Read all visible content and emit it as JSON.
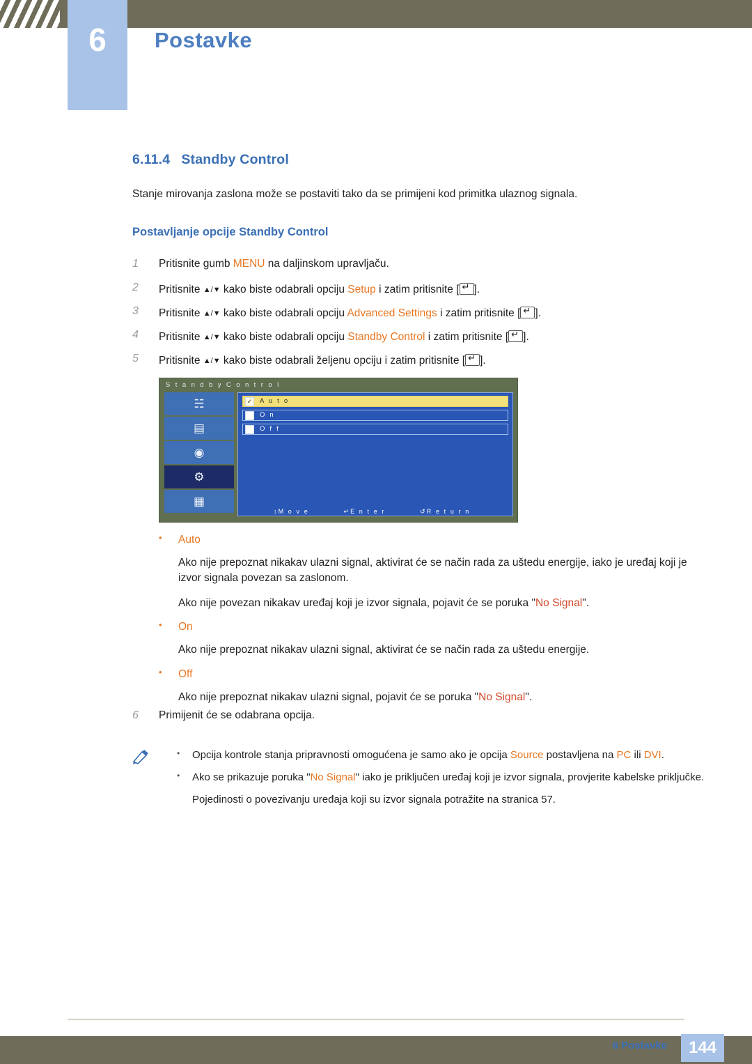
{
  "header": {
    "chapter_number": "6",
    "chapter_title": "Postavke"
  },
  "section": {
    "number": "6.11.4",
    "title": "Standby Control",
    "intro": "Stanje mirovanja zaslona može se postaviti tako da se primijeni kod primitka ulaznog signala.",
    "subhead": "Postavljanje opcije Standby Control"
  },
  "steps": [
    {
      "index": "1",
      "pre": "Pritisnite gumb ",
      "key": "MENU",
      "post": " na daljinskom upravljaču.",
      "type": "menu"
    },
    {
      "index": "2",
      "pre": "Pritisnite ",
      "arrows": "▲/▼",
      "mid": " kako biste odabrali opciju ",
      "target": "Setup",
      "post": " i zatim pritisnite [",
      "tail": "].",
      "type": "nav"
    },
    {
      "index": "3",
      "pre": "Pritisnite ",
      "arrows": "▲/▼",
      "mid": " kako biste odabrali opciju ",
      "target": "Advanced Settings",
      "post": " i zatim pritisnite [",
      "tail": "].",
      "type": "nav"
    },
    {
      "index": "4",
      "pre": "Pritisnite ",
      "arrows": "▲/▼",
      "mid": " kako biste odabrali opciju ",
      "target": "Standby Control",
      "post": " i zatim pritisnite [",
      "tail": "].",
      "type": "nav"
    },
    {
      "index": "5",
      "pre": "Pritisnite ",
      "arrows": "▲/▼",
      "mid": " kako biste odabrali željenu opciju i zatim pritisnite [",
      "target": "",
      "post": "",
      "tail": "].",
      "type": "nav-plain"
    }
  ],
  "osd": {
    "title": "S t a n d b y   C o n t r o l",
    "sidebar_icons": [
      "picture-icon",
      "screen-icon",
      "sound-icon",
      "setup-gear-icon",
      "multicontrol-icon"
    ],
    "options": [
      {
        "label": "A u t o",
        "checked": "✓",
        "highlighted": true
      },
      {
        "label": "O n",
        "checked": "",
        "highlighted": false
      },
      {
        "label": "O f f",
        "checked": "",
        "highlighted": false
      }
    ],
    "footer": {
      "move": "M o v e",
      "enter": "E n t e r",
      "return": "R e t u r n",
      "move_icon": "up-down-arrows-icon",
      "enter_icon": "enter-key-icon",
      "return_icon": "return-arrow-icon"
    }
  },
  "options_detail": [
    {
      "label": "Auto",
      "paragraphs": [
        "Ako nije prepoznat nikakav ulazni signal, aktivirat će se način rada za uštedu energije, iako je uređaj koji je izvor signala povezan sa zaslonom.",
        "Ako nije povezan nikakav uređaj koji je izvor signala, pojavit će se poruka \"No Signal\"."
      ],
      "nosignal_in": [
        1
      ]
    },
    {
      "label": "On",
      "paragraphs": [
        "Ako nije prepoznat nikakav ulazni signal, aktivirat će se način rada za uštedu energije."
      ],
      "nosignal_in": []
    },
    {
      "label": "Off",
      "paragraphs": [
        "Ako nije prepoznat nikakav ulazni signal, pojavit će se poruka \"No Signal\"."
      ],
      "nosignal_in": [
        0
      ]
    }
  ],
  "strings": {
    "no_signal": "No Signal",
    "quote_open": "\"",
    "quote_close": "\""
  },
  "step6": {
    "index": "6",
    "text": "Primijenit će se odabrana opcija."
  },
  "note": {
    "icon": "note-pencil-icon",
    "items": [
      {
        "pre": "Opcija kontrole stanja pripravnosti omogućena je samo ako je opcija ",
        "kw1": "Source",
        "mid": " postavljena na ",
        "kw2": "PC",
        "post": " ili ",
        "kw3": "DVI",
        "tail": "."
      },
      {
        "pre": "Ako se prikazuje poruka \"",
        "kw1": "No Signal",
        "post": "\" iako je priključen uređaj koji je izvor signala, provjerite kabelske priključke."
      }
    ],
    "plain": "Pojedinosti o povezivanju uređaja koji su izvor signala potražite na stranica 57."
  },
  "footer": {
    "label": "6 Postavke",
    "page": "144"
  },
  "colors": {
    "heading_blue": "#3a6fb5",
    "accent_orange": "#e87722",
    "accent_red": "#d2492a",
    "band": "#6f6c5a",
    "chapter_box": "#a9c2e8"
  }
}
